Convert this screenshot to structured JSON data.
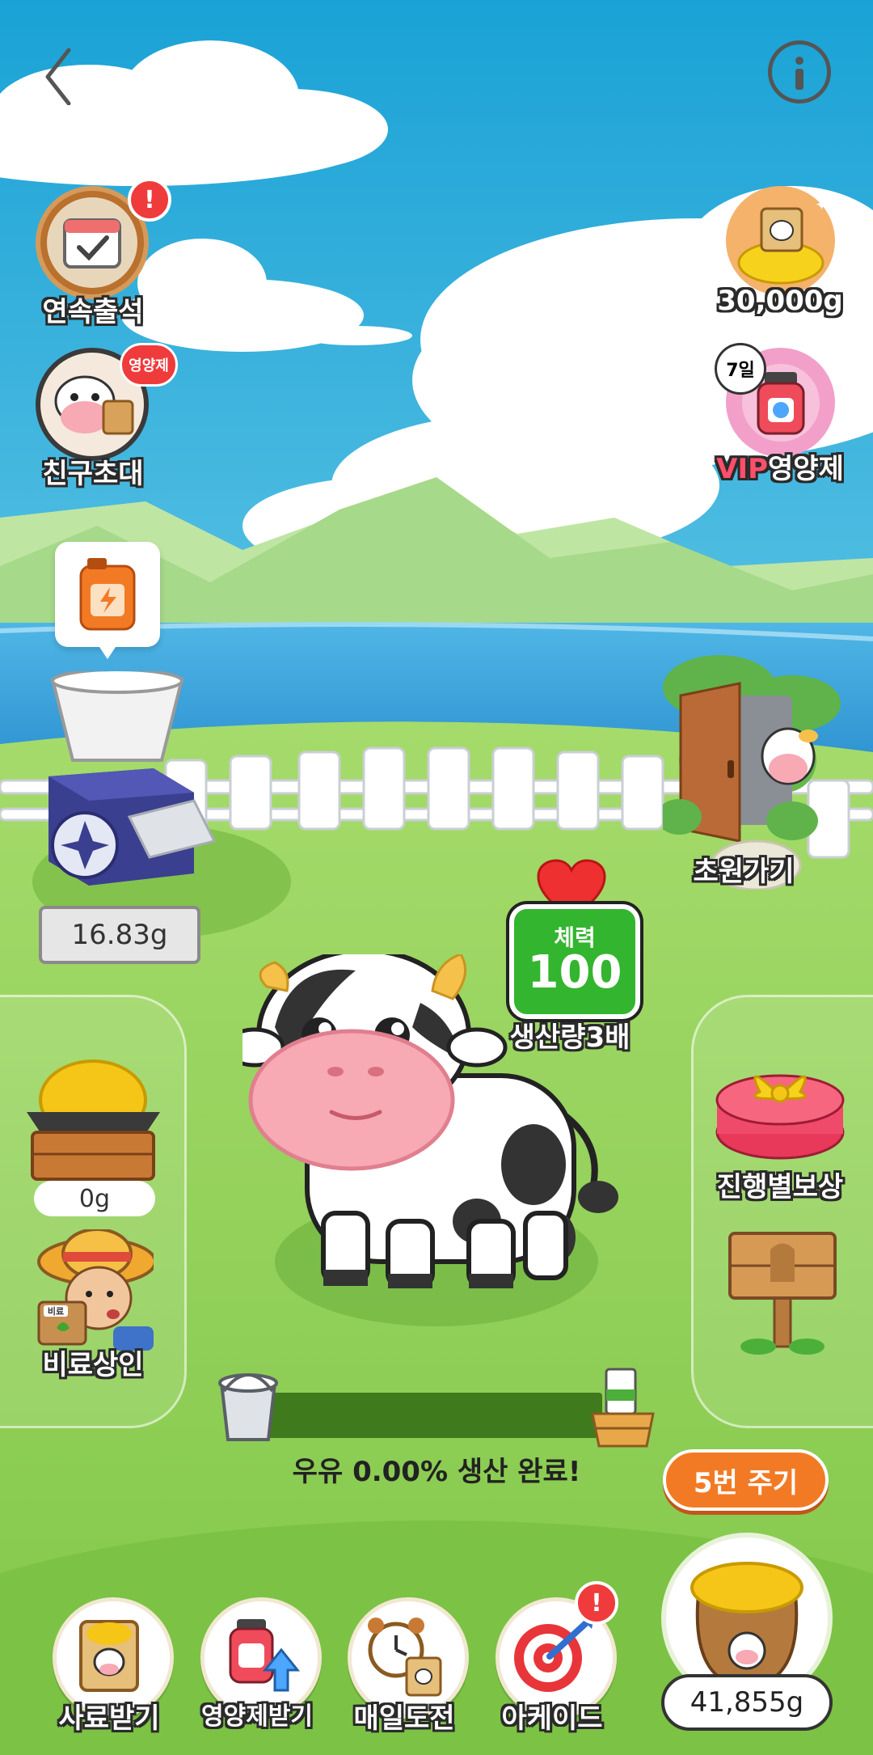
{
  "header": {
    "back_icon": "chevron-left-icon",
    "info_icon": "info-icon"
  },
  "left_menu": {
    "attendance": {
      "label": "연속출석",
      "icon": "calendar-check-icon",
      "alert": "!"
    },
    "invite": {
      "label": "친구초대",
      "badge": "영양제",
      "icon": "cow-friend-icon"
    }
  },
  "right_menu": {
    "gold": {
      "label": "30,000g",
      "icon": "feed-bag-gold-icon"
    },
    "vip": {
      "label_prefix": "VIP",
      "label_suffix": "영양제",
      "badge": "7일",
      "icon": "supplement-bottle-icon"
    }
  },
  "grinder": {
    "bubble_icon": "fuel-can-icon",
    "amount": "16.83g"
  },
  "meadow": {
    "label": "초원가기",
    "icon": "door-icon"
  },
  "stamina": {
    "label": "체력",
    "value": "100",
    "boost": "생산량3배",
    "icon": "heart-icon"
  },
  "feed_tray": {
    "amount": "0g"
  },
  "fertilizer": {
    "label": "비료상인",
    "sign": "비료"
  },
  "reward": {
    "label": "진행별보상",
    "icon": "gift-box-icon"
  },
  "signpost": {
    "icon": "wooden-sign-icon"
  },
  "milk": {
    "status_text": "우유 0.00% 생산 완료!",
    "progress": 0.0
  },
  "give_button": {
    "label": "5번 주기"
  },
  "feed_sack": {
    "amount": "41,855g"
  },
  "bottom_nav": [
    {
      "label": "사료받기",
      "icon": "feed-bag-icon"
    },
    {
      "label": "영양제받기",
      "icon": "supplement-up-icon"
    },
    {
      "label": "매일도전",
      "icon": "alarm-clock-icon"
    },
    {
      "label": "아케이드",
      "icon": "dart-target-icon",
      "alert": "!"
    }
  ],
  "colors": {
    "sky": "#1fa8d8",
    "grass": "#8ccf4f",
    "accent_orange": "#f37a24",
    "stamina_green": "#33b52f",
    "progress_track": "#3f7a1c"
  }
}
